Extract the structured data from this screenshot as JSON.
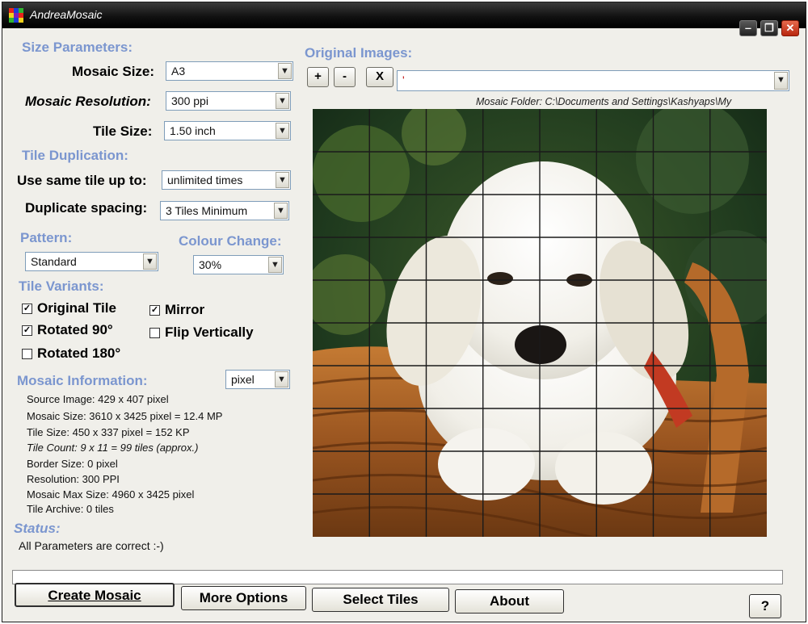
{
  "window": {
    "title": "AndreaMosaic"
  },
  "size_parameters": {
    "heading": "Size Parameters:",
    "mosaic_size_label": "Mosaic Size:",
    "mosaic_size_value": "A3",
    "mosaic_resolution_label": "Mosaic Resolution:",
    "mosaic_resolution_value": "300 ppi",
    "tile_size_label": "Tile Size:",
    "tile_size_value": "1.50 inch"
  },
  "tile_duplication": {
    "heading": "Tile Duplication:",
    "same_tile_label": "Use same tile up to:",
    "same_tile_value": "unlimited times",
    "spacing_label": "Duplicate spacing:",
    "spacing_value": "3 Tiles Minimum"
  },
  "pattern": {
    "heading": "Pattern:",
    "value": "Standard"
  },
  "colour_change": {
    "heading": "Colour Change:",
    "value": "30%"
  },
  "tile_variants": {
    "heading": "Tile Variants:",
    "original_tile": {
      "label": "Original Tile",
      "checked": true
    },
    "mirror": {
      "label": "Mirror",
      "checked": true
    },
    "rotated_90": {
      "label": "Rotated 90°",
      "checked": true
    },
    "flip_vertically": {
      "label": "Flip Vertically",
      "checked": false
    },
    "rotated_180": {
      "label": "Rotated 180°",
      "checked": false
    }
  },
  "mosaic_info": {
    "heading": "Mosaic Information:",
    "unit_value": "pixel",
    "lines": [
      "Source Image: 429 x 407 pixel",
      "Mosaic Size: 3610 x 3425 pixel = 12.4 MP",
      "Tile Size: 450 x 337 pixel = 152 KP",
      "Tile Count: 9 x 11 = 99 tiles (approx.)",
      "Border Size: 0 pixel",
      "Resolution: 300 PPI",
      "Mosaic Max Size: 4960 x 3425 pixel",
      "Tile Archive: 0 tiles"
    ]
  },
  "status": {
    "heading": "Status:",
    "text": "All Parameters are correct :-)"
  },
  "original_images": {
    "heading": "Original Images:",
    "add_label": "+",
    "remove_label": "-",
    "clear_label": "X",
    "path_value": "'",
    "mosaic_folder": "Mosaic Folder: C:\\Documents and Settings\\Kashyaps\\My"
  },
  "preview": {
    "columns": 8,
    "rows": 10,
    "grid_color": "#1a1a1a"
  },
  "buttons": {
    "create": "Create Mosaic",
    "more": "More Options",
    "select": "Select Tiles",
    "about": "About",
    "help": "?"
  },
  "colors": {
    "section_heading": "#7b96cf",
    "close_button": "#c8361a"
  }
}
